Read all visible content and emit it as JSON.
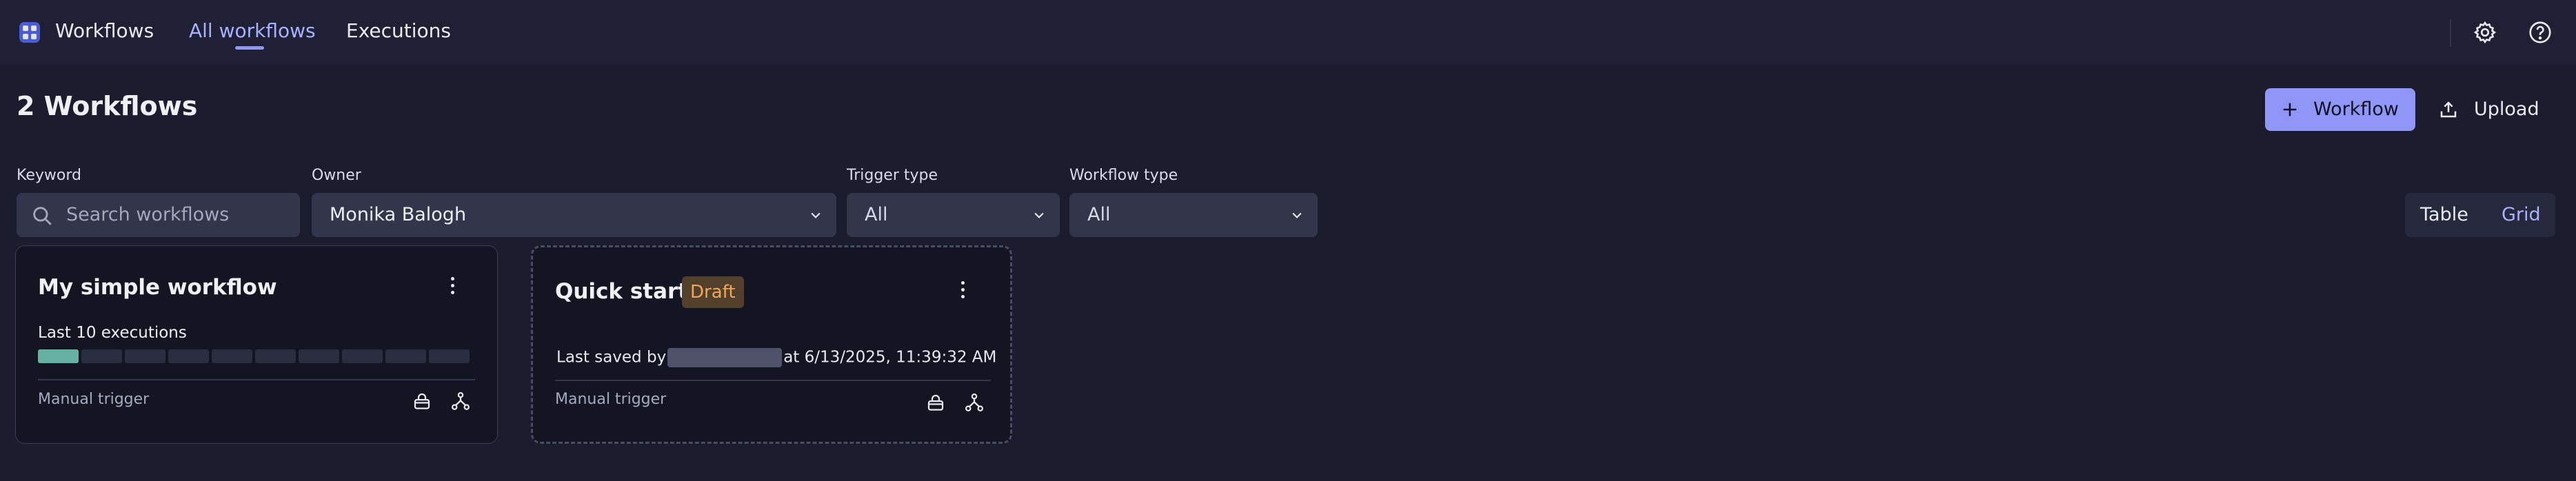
{
  "header": {
    "app_title": "Workflows",
    "tabs": [
      {
        "label": "All workflows",
        "active": true
      },
      {
        "label": "Executions",
        "active": false
      }
    ],
    "icons": [
      "settings-icon",
      "help-icon"
    ]
  },
  "page": {
    "title": "2 Workflows",
    "add_button_label": "Workflow",
    "upload_button_label": "Upload"
  },
  "filters": {
    "keyword": {
      "label": "Keyword",
      "placeholder": "Search workflows",
      "value": ""
    },
    "owner": {
      "label": "Owner",
      "value": "Monika Balogh"
    },
    "trigger_type": {
      "label": "Trigger type",
      "value": "All"
    },
    "workflow_type": {
      "label": "Workflow type",
      "value": "All"
    }
  },
  "view_toggle": {
    "options": [
      "Table",
      "Grid"
    ],
    "selected": "Grid"
  },
  "workflows": [
    {
      "title": "My simple workflow",
      "executions_label": "Last 10 executions",
      "executions_ok": 1,
      "executions_total": 10,
      "trigger": "Manual trigger",
      "icons": [
        "lock-icon",
        "workflow-graph-icon"
      ]
    },
    {
      "title": "Quick start",
      "badge": "Draft",
      "saved_prefix": "Last saved by",
      "saved_suffix": "at 6/13/2025, 11:39:32 AM",
      "trigger": "Manual trigger",
      "icons": [
        "lock-icon",
        "workflow-graph-icon"
      ]
    }
  ],
  "colors": {
    "accent": "#8f96f5",
    "success": "#64b3a2",
    "draft": "#f2a65a",
    "background": "#1b1c2e"
  }
}
